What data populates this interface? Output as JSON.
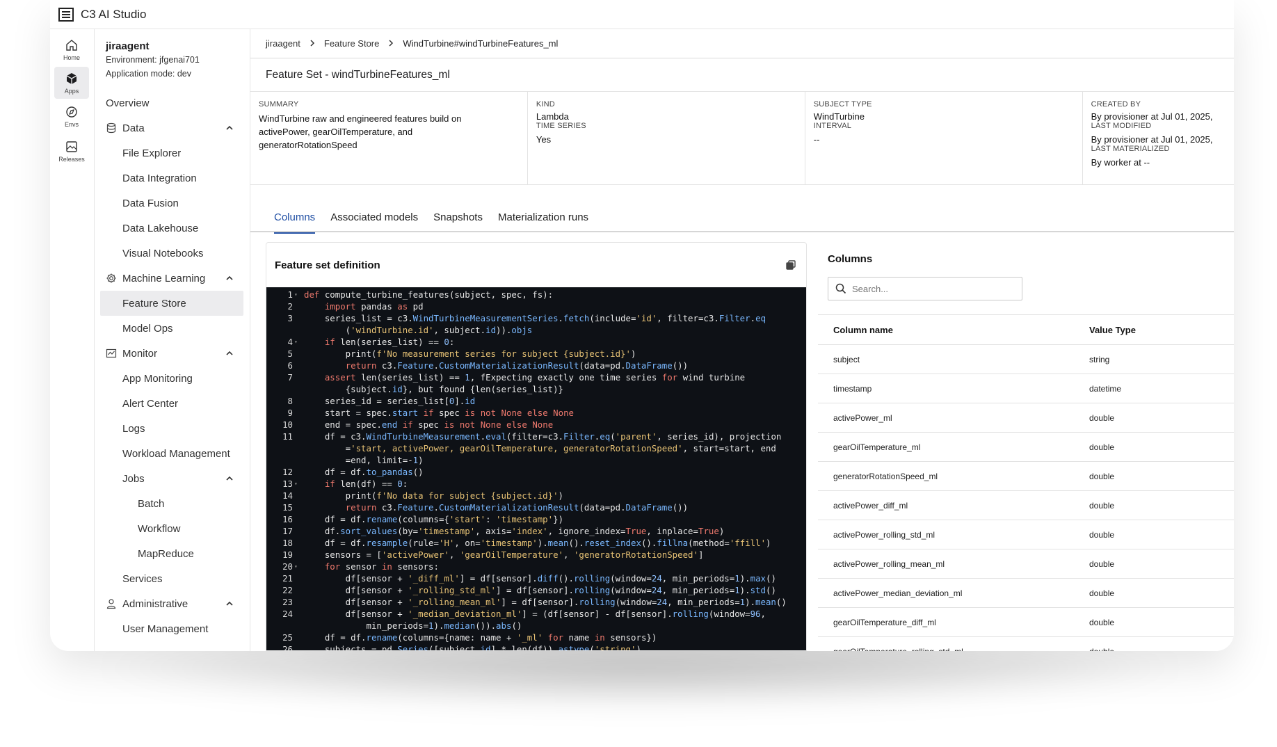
{
  "app": {
    "title": "C3 AI Studio"
  },
  "rail": [
    {
      "label": "Home",
      "icon": "home-icon"
    },
    {
      "label": "Apps",
      "icon": "apps-icon"
    },
    {
      "label": "Envs",
      "icon": "envs-icon"
    },
    {
      "label": "Releases",
      "icon": "releases-icon"
    }
  ],
  "appinfo": {
    "name": "jiraagent",
    "environment": "Environment: jfgenai701",
    "mode": "Application mode: dev"
  },
  "nav": {
    "overview": "Overview",
    "data": "Data",
    "file_explorer": "File Explorer",
    "data_integration": "Data Integration",
    "data_fusion": "Data Fusion",
    "data_lakehouse": "Data Lakehouse",
    "visual_notebooks": "Visual Notebooks",
    "machine_learning": "Machine Learning",
    "feature_store": "Feature Store",
    "model_ops": "Model Ops",
    "monitor": "Monitor",
    "app_monitoring": "App Monitoring",
    "alert_center": "Alert Center",
    "logs": "Logs",
    "workload_management": "Workload Management",
    "jobs": "Jobs",
    "batch": "Batch",
    "workflow": "Workflow",
    "mapreduce": "MapReduce",
    "services": "Services",
    "administrative": "Administrative",
    "user_management": "User Management"
  },
  "breadcrumb": {
    "c1": "jiraagent",
    "c2": "Feature Store",
    "c3": "WindTurbine#windTurbineFeatures_ml"
  },
  "featureset": {
    "title": "Feature Set - windTurbineFeatures_ml"
  },
  "summary": {
    "summary_label": "SUMMARY",
    "summary_text": "WindTurbine raw and engineered features build on activePower, gearOilTemperature, and generatorRotationSpeed",
    "kind_label": "KIND",
    "kind_value": "Lambda",
    "timeseries_label": "TIME SERIES",
    "timeseries_value": "Yes",
    "subject_label": "SUBJECT TYPE",
    "subject_value": "WindTurbine",
    "interval_label": "INTERVAL",
    "interval_value": "--",
    "created_label": "CREATED BY",
    "created_value": "By provisioner at Jul 01, 2025,",
    "modified_label": "LAST MODIFIED",
    "modified_value": "By provisioner at Jul 01, 2025,",
    "materialized_label": "LAST MATERIALIZED",
    "materialized_value": "By worker at --"
  },
  "tabs": {
    "t1": "Columns",
    "t2": "Associated models",
    "t3": "Snapshots",
    "t4": "Materialization runs"
  },
  "definition": {
    "title": "Feature set definition"
  },
  "code_lines": [
    {
      "n": "1",
      "fold": true,
      "code": "def compute_turbine_features(subject, spec, fs):"
    },
    {
      "n": "2",
      "code": "    import pandas as pd"
    },
    {
      "n": "3",
      "code": "    series_list = c3.WindTurbineMeasurementSeries.fetch(include='id', filter=c3.Filter.eq"
    },
    {
      "n": "",
      "code": "        ('windTurbine.id', subject.id)).objs"
    },
    {
      "n": "4",
      "fold": true,
      "code": "    if len(series_list) == 0:"
    },
    {
      "n": "5",
      "code": "        print(f'No measurement series for subject {subject.id}')"
    },
    {
      "n": "6",
      "code": "        return c3.Feature.CustomMaterializationResult(data=pd.DataFrame())"
    },
    {
      "n": "7",
      "code": "    assert len(series_list) == 1, f'Expecting exactly one time series for wind turbine"
    },
    {
      "n": "",
      "code": "        {subject.id}, but found {len(series_list)}'"
    },
    {
      "n": "8",
      "code": "    series_id = series_list[0].id"
    },
    {
      "n": "9",
      "code": "    start = spec.start if spec is not None else None"
    },
    {
      "n": "10",
      "code": "    end = spec.end if spec is not None else None"
    },
    {
      "n": "11",
      "code": "    df = c3.WindTurbineMeasurement.eval(filter=c3.Filter.eq('parent', series_id), projection"
    },
    {
      "n": "",
      "code": "        ='start, activePower, gearOilTemperature, generatorRotationSpeed', start=start, end"
    },
    {
      "n": "",
      "code": "        =end, limit=-1)"
    },
    {
      "n": "12",
      "code": "    df = df.to_pandas()"
    },
    {
      "n": "13",
      "fold": true,
      "code": "    if len(df) == 0:"
    },
    {
      "n": "14",
      "code": "        print(f'No data for subject {subject.id}')"
    },
    {
      "n": "15",
      "code": "        return c3.Feature.CustomMaterializationResult(data=pd.DataFrame())"
    },
    {
      "n": "16",
      "code": "    df = df.rename(columns={'start': 'timestamp'})"
    },
    {
      "n": "17",
      "code": "    df.sort_values(by='timestamp', axis='index', ignore_index=True, inplace=True)"
    },
    {
      "n": "18",
      "code": "    df = df.resample(rule='H', on='timestamp').mean().reset_index().fillna(method='ffill')"
    },
    {
      "n": "19",
      "code": "    sensors = ['activePower', 'gearOilTemperature', 'generatorRotationSpeed']"
    },
    {
      "n": "20",
      "fold": true,
      "code": "    for sensor in sensors:"
    },
    {
      "n": "21",
      "code": "        df[sensor + '_diff_ml'] = df[sensor].diff().rolling(window=24, min_periods=1).max()"
    },
    {
      "n": "22",
      "code": "        df[sensor + '_rolling_std_ml'] = df[sensor].rolling(window=24, min_periods=1).std()"
    },
    {
      "n": "23",
      "code": "        df[sensor + '_rolling_mean_ml'] = df[sensor].rolling(window=24, min_periods=1).mean()"
    },
    {
      "n": "24",
      "code": "        df[sensor + '_median_deviation_ml'] = (df[sensor] - df[sensor].rolling(window=96,"
    },
    {
      "n": "",
      "code": "            min_periods=1).median()).abs()"
    },
    {
      "n": "25",
      "code": "    df = df.rename(columns={name: name + '_ml' for name in sensors})"
    },
    {
      "n": "26",
      "code": "    subjects = pd.Series([subject.id] * len(df)).astype('string')"
    }
  ],
  "columns": {
    "title": "Columns",
    "search_placeholder": "Search...",
    "header_name": "Column name",
    "header_type": "Value Type",
    "rows": [
      {
        "name": "subject",
        "type": "string"
      },
      {
        "name": "timestamp",
        "type": "datetime"
      },
      {
        "name": "activePower_ml",
        "type": "double"
      },
      {
        "name": "gearOilTemperature_ml",
        "type": "double"
      },
      {
        "name": "generatorRotationSpeed_ml",
        "type": "double"
      },
      {
        "name": "activePower_diff_ml",
        "type": "double"
      },
      {
        "name": "activePower_rolling_std_ml",
        "type": "double"
      },
      {
        "name": "activePower_rolling_mean_ml",
        "type": "double"
      },
      {
        "name": "activePower_median_deviation_ml",
        "type": "double"
      },
      {
        "name": "gearOilTemperature_diff_ml",
        "type": "double"
      },
      {
        "name": "gearOilTemperature_rolling_std_ml",
        "type": "double"
      }
    ]
  }
}
